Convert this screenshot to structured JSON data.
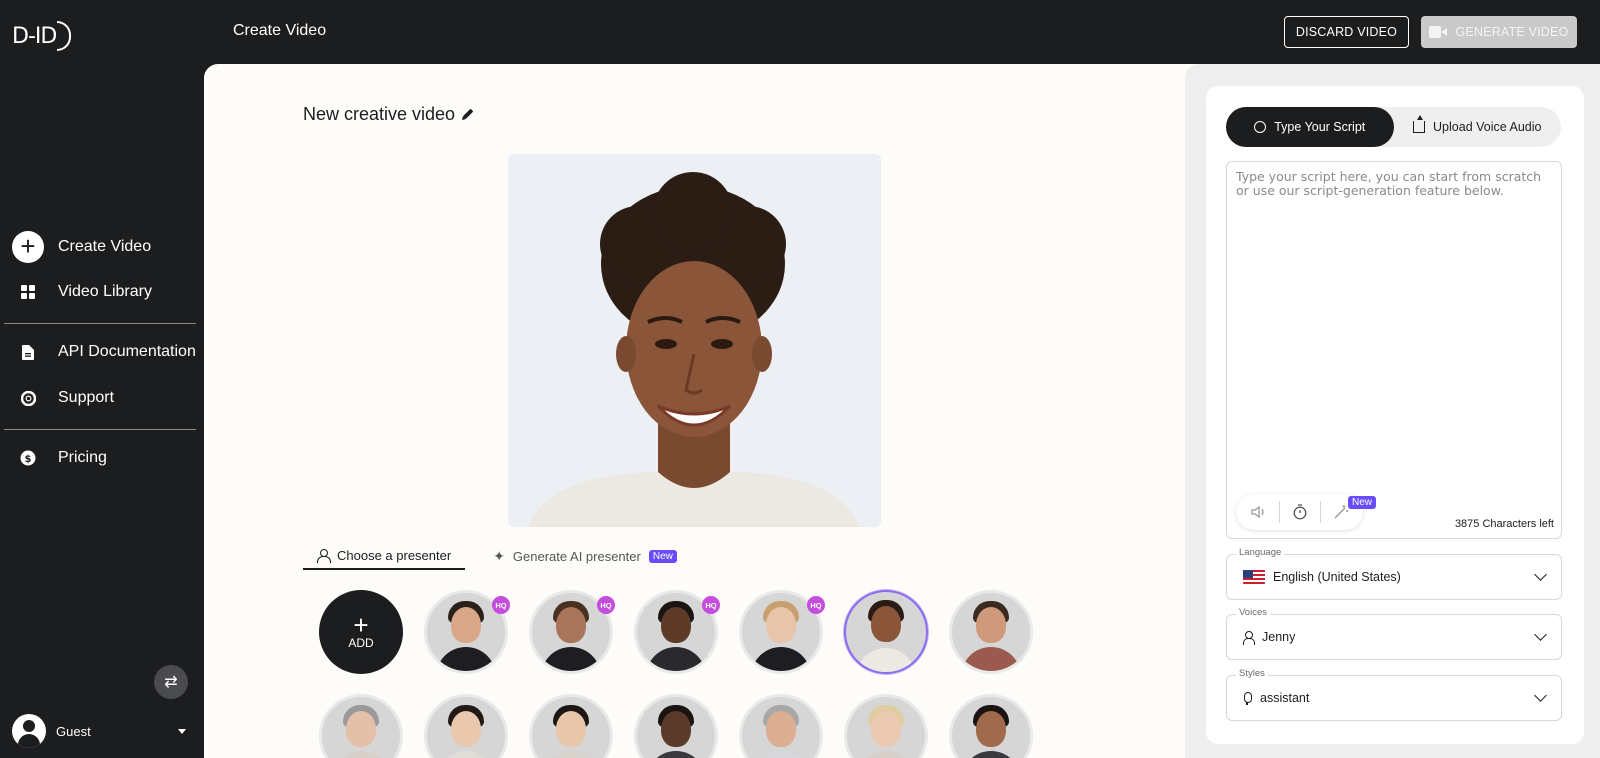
{
  "app": {
    "logo": "D-ID",
    "page_title": "Create Video"
  },
  "header": {
    "discard_label": "DISCARD VIDEO",
    "generate_label": "GENERATE VIDEO"
  },
  "sidebar": {
    "items": [
      {
        "label": "Create Video",
        "icon": "plus-circle-icon"
      },
      {
        "label": "Video Library",
        "icon": "grid-icon"
      },
      {
        "label": "API Documentation",
        "icon": "document-icon"
      },
      {
        "label": "Support",
        "icon": "lifebuoy-icon"
      },
      {
        "label": "Pricing",
        "icon": "dollar-icon"
      }
    ],
    "user": {
      "name": "Guest"
    }
  },
  "main": {
    "video_title": "New creative video",
    "presenter_tabs": [
      {
        "label": "Choose a presenter",
        "active": true
      },
      {
        "label": "Generate AI presenter",
        "badge": "New",
        "active": false
      }
    ],
    "add_label": "ADD",
    "hq_label": "HQ",
    "presenters_row1": [
      {
        "hq": true,
        "skin": "#d9a787",
        "hair": "#2b211b",
        "outfit": "#1e1e22"
      },
      {
        "hq": true,
        "skin": "#a8745a",
        "hair": "#4a3020",
        "outfit": "#1e1e22"
      },
      {
        "hq": true,
        "skin": "#5e3a28",
        "hair": "#1a1412",
        "outfit": "#2a2a2e"
      },
      {
        "hq": true,
        "skin": "#e8c4aa",
        "hair": "#c8a070",
        "outfit": "#1e1e22"
      },
      {
        "hq": false,
        "selected": true,
        "skin": "#8a5538",
        "hair": "#2a1c14",
        "outfit": "#ece8e2"
      },
      {
        "hq": false,
        "skin": "#cf9a7c",
        "hair": "#3a2a20",
        "outfit": "#9a5a50"
      }
    ],
    "presenters_row2": [
      {
        "skin": "#e4c0a8",
        "hair": "#9a9a9a",
        "outfit": "#d8d0c8"
      },
      {
        "skin": "#eac8ae",
        "hair": "#221a16",
        "outfit": "#e0dcd6"
      },
      {
        "skin": "#e8c6aa",
        "hair": "#1c1614",
        "outfit": "#d8d4cc"
      },
      {
        "skin": "#5a3a28",
        "hair": "#1a1412",
        "outfit": "#3a3a3e"
      },
      {
        "skin": "#dcae92",
        "hair": "#a8a8a8",
        "outfit": "#d8d8dc"
      },
      {
        "skin": "#eccab2",
        "hair": "#e0cca0",
        "outfit": "#d8d0c8"
      },
      {
        "skin": "#a06a4c",
        "hair": "#1c1412",
        "outfit": "#3a3a3e"
      }
    ]
  },
  "script_panel": {
    "tabs": [
      {
        "label": "Type Your Script",
        "icon": "chat-icon",
        "active": true
      },
      {
        "label": "Upload Voice Audio",
        "icon": "upload-icon",
        "active": false
      }
    ],
    "placeholder": "Type your script here, you can start from scratch or use our script-generation feature below.",
    "tools_badge": "New",
    "chars_left": "3875 Characters left",
    "language": {
      "label": "Language",
      "value": "English (United States)"
    },
    "voices": {
      "label": "Voices",
      "value": "Jenny"
    },
    "styles": {
      "label": "Styles",
      "value": "assistant"
    }
  },
  "colors": {
    "dark": "#1c1d1f",
    "accent_purple": "#6b4bff",
    "hq_badge": "#c44dde"
  }
}
